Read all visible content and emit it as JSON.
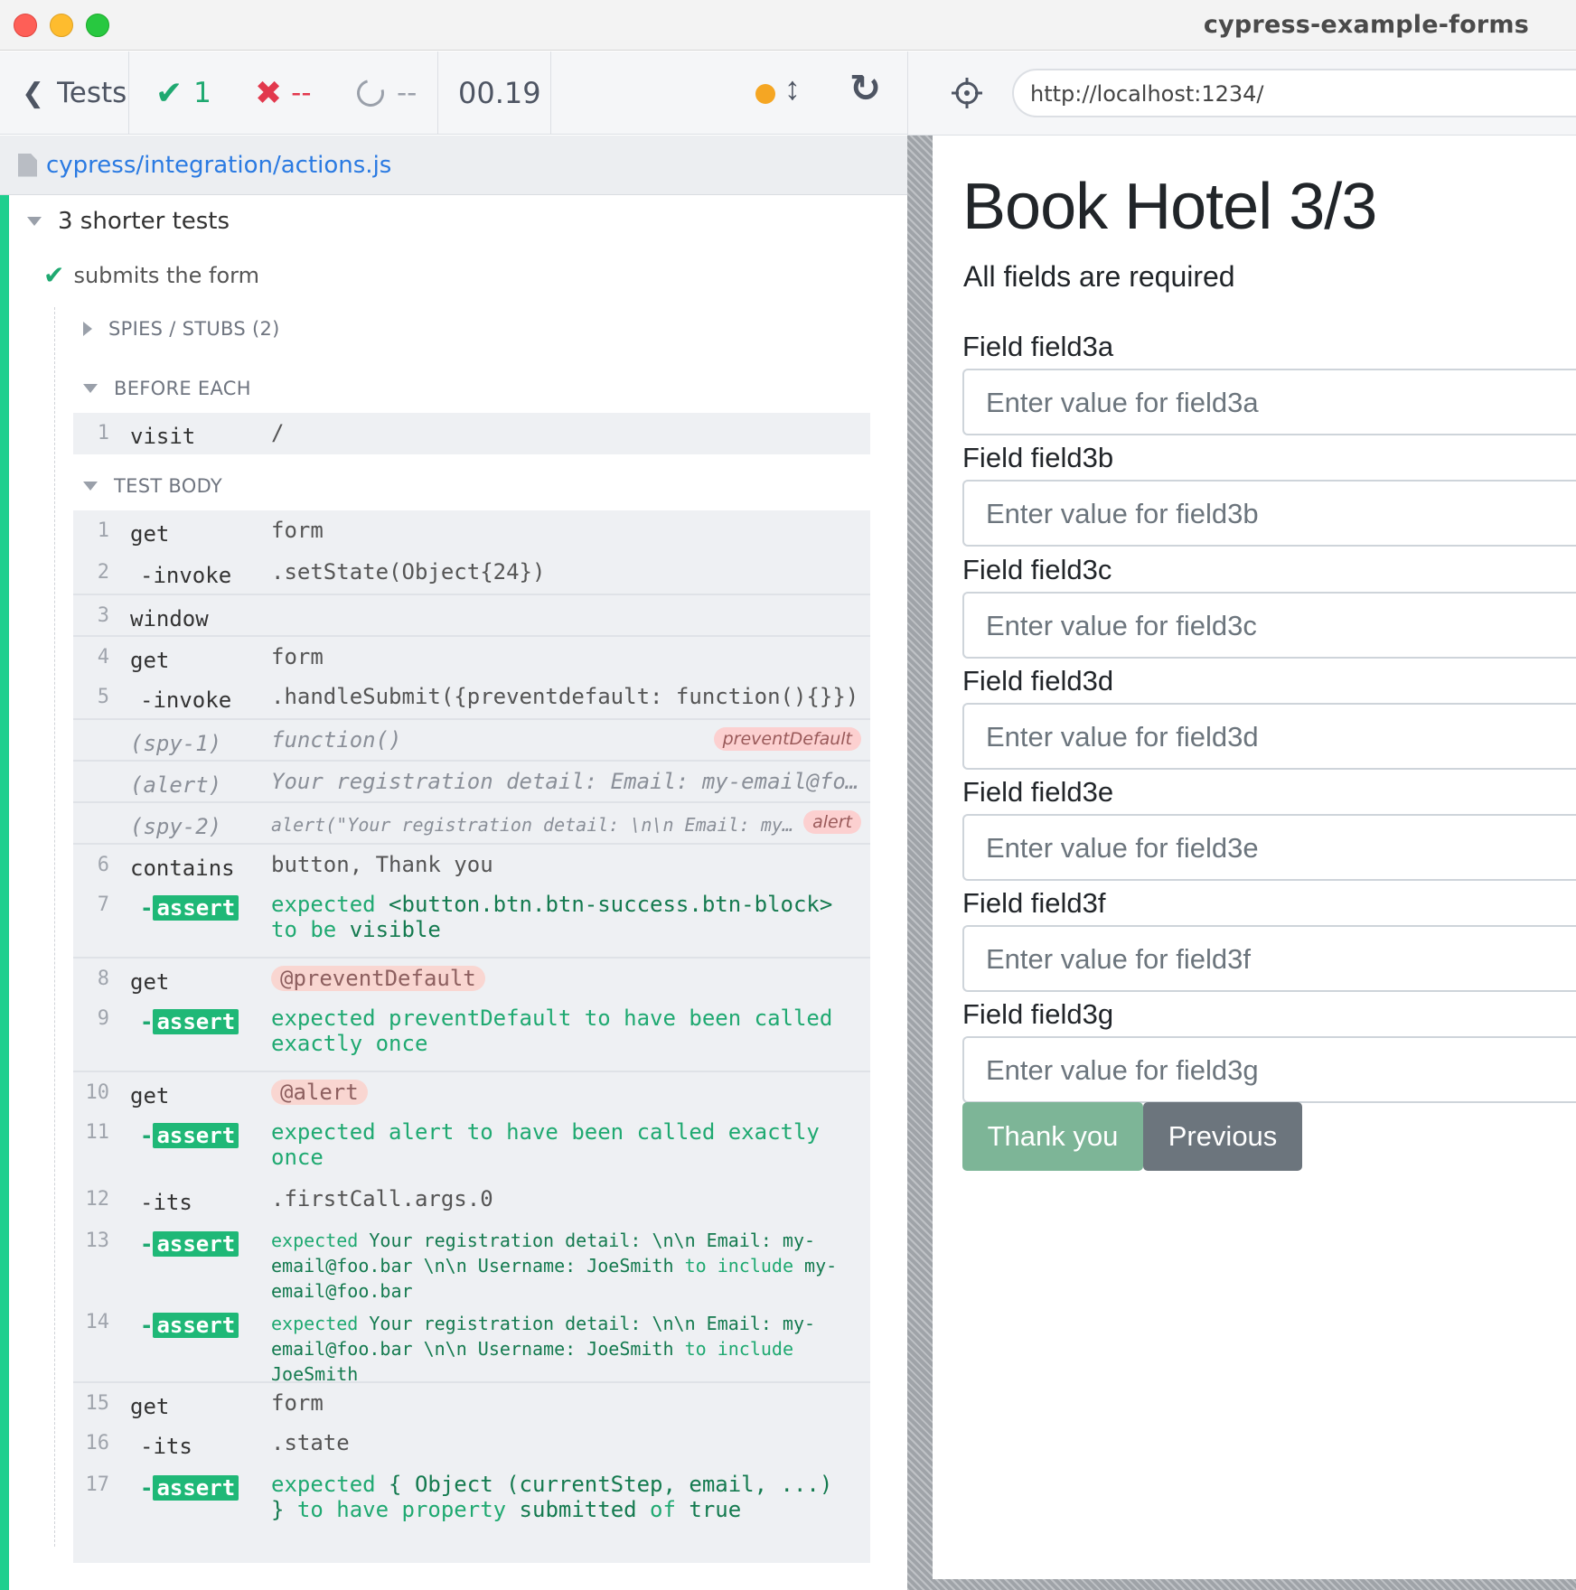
{
  "window": {
    "title": "cypress-example-forms"
  },
  "header": {
    "tests_label": "Tests",
    "passed": "1",
    "failed": "--",
    "pending": "--",
    "duration": "00.19",
    "status_color": "#f5a623"
  },
  "spec": {
    "path": "cypress/integration/actions.js"
  },
  "suite": {
    "title": "3 shorter tests"
  },
  "test": {
    "title": "submits the form"
  },
  "hooks": {
    "spies": "SPIES / STUBS (2)",
    "before_each": "BEFORE EACH",
    "test_body": "TEST BODY"
  },
  "before_each_cmds": [
    {
      "num": "1",
      "name": "visit",
      "message": "/"
    }
  ],
  "cmds": {
    "c1": {
      "num": "1",
      "name": "get",
      "message": "form"
    },
    "c2": {
      "num": "2",
      "name": "-invoke",
      "message": ".setState(Object{24})"
    },
    "c3": {
      "num": "3",
      "name": "window",
      "message": ""
    },
    "c4": {
      "num": "4",
      "name": "get",
      "message": "form"
    },
    "c5": {
      "num": "5",
      "name": "-invoke",
      "message": ".handleSubmit({preventdefault: function(){}})"
    },
    "spy1": {
      "name": "(spy-1)",
      "message": "function()",
      "badge": "preventDefault"
    },
    "alert": {
      "name": "(alert)",
      "message": "Your registration detail: Email: my-email@fo…"
    },
    "spy2": {
      "name": "(spy-2)",
      "message": "alert(\"Your registration detail: \\n\\n Email: my…",
      "badge": "alert"
    },
    "c6": {
      "num": "6",
      "name": "contains",
      "message": "button, Thank you"
    },
    "c7": {
      "num": "7",
      "name": "assert",
      "l1a": "expected",
      "l1b": "<button.btn.btn-success.btn-block>",
      "l2a": "to be",
      "l2b": "visible"
    },
    "c8": {
      "num": "8",
      "name": "get",
      "message": "@preventDefault"
    },
    "c9": {
      "num": "9",
      "name": "assert",
      "l1": "expected preventDefault to have been called",
      "l2": "exactly once"
    },
    "c10": {
      "num": "10",
      "name": "get",
      "message": "@alert"
    },
    "c11": {
      "num": "11",
      "name": "assert",
      "l1": "expected alert to have been called exactly",
      "l2": "once"
    },
    "c12": {
      "num": "12",
      "name": "-its",
      "message": ".firstCall.args.0"
    },
    "c13": {
      "num": "13",
      "name": "assert",
      "l1a": "expected",
      "l1b": "Your registration detail: \\n\\n Email: my-",
      "l2a": "email@foo.bar \\n\\n Username: JoeSmith",
      "l2b": "to include",
      "l2c": "my-",
      "l3": "email@foo.bar"
    },
    "c14": {
      "num": "14",
      "name": "assert",
      "l1a": "expected",
      "l1b": "Your registration detail: \\n\\n Email: my-",
      "l2a": "email@foo.bar \\n\\n Username: JoeSmith",
      "l2b": "to include",
      "l3": "JoeSmith"
    },
    "c15": {
      "num": "15",
      "name": "get",
      "message": "form"
    },
    "c16": {
      "num": "16",
      "name": "-its",
      "message": ".state"
    },
    "c17": {
      "num": "17",
      "name": "assert",
      "l1a": "expected",
      "l1b": "{ Object (currentStep, email, ...)",
      "l2a": "}",
      "l2b": "to have property",
      "l2c": "submitted",
      "l2d": "of",
      "l2e": "true"
    }
  },
  "browser": {
    "url": "http://localhost:1234/"
  },
  "app": {
    "title": "Book Hotel 3/3",
    "subtitle": "All fields are required",
    "fields": [
      {
        "label": "Field field3a",
        "placeholder": "Enter value for field3a"
      },
      {
        "label": "Field field3b",
        "placeholder": "Enter value for field3b"
      },
      {
        "label": "Field field3c",
        "placeholder": "Enter value for field3c"
      },
      {
        "label": "Field field3d",
        "placeholder": "Enter value for field3d"
      },
      {
        "label": "Field field3e",
        "placeholder": "Enter value for field3e"
      },
      {
        "label": "Field field3f",
        "placeholder": "Enter value for field3f"
      },
      {
        "label": "Field field3g",
        "placeholder": "Enter value for field3g"
      }
    ],
    "submit_label": "Thank you",
    "previous_label": "Previous"
  }
}
